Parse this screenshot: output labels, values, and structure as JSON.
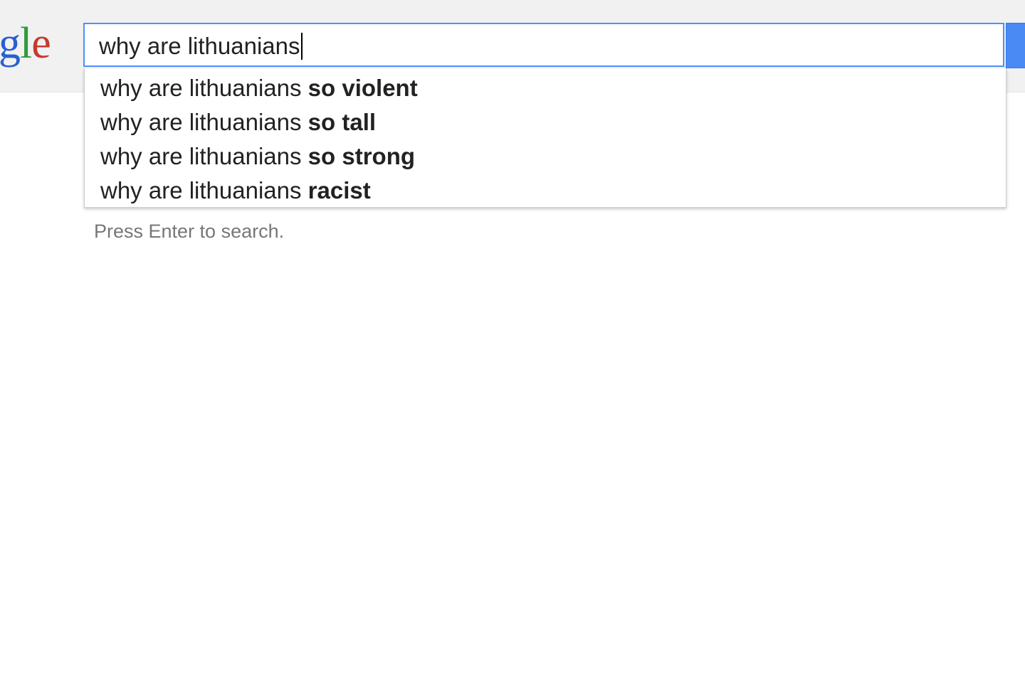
{
  "logo": {
    "part1": "g",
    "part2": "l",
    "part3": "e"
  },
  "search": {
    "query": "why are lithuanians",
    "suggestions": [
      {
        "prefix": "why are lithuanians",
        "completion": "so violent"
      },
      {
        "prefix": "why are lithuanians",
        "completion": "so tall"
      },
      {
        "prefix": "why are lithuanians",
        "completion": "so strong"
      },
      {
        "prefix": "why are lithuanians",
        "completion": "racist"
      }
    ],
    "hint": "Press Enter to search."
  },
  "colors": {
    "accent_blue": "#4d90fe",
    "search_button": "#4a8af4",
    "logo_blue": "#2a5fd1",
    "logo_green": "#2f9a3b",
    "logo_red": "#c63a2d"
  }
}
